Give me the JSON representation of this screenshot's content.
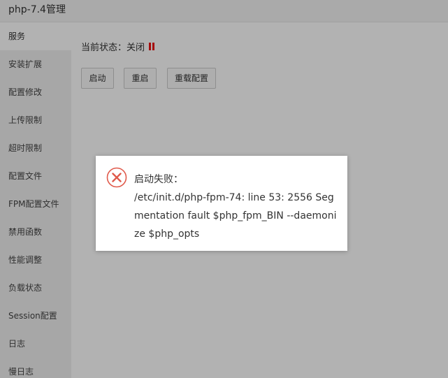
{
  "window": {
    "title": "php-7.4管理"
  },
  "sidebar": {
    "items": [
      {
        "label": "服务",
        "active": true
      },
      {
        "label": "安装扩展"
      },
      {
        "label": "配置修改"
      },
      {
        "label": "上传限制"
      },
      {
        "label": "超时限制"
      },
      {
        "label": "配置文件"
      },
      {
        "label": "FPM配置文件"
      },
      {
        "label": "禁用函数"
      },
      {
        "label": "性能调整"
      },
      {
        "label": "负载状态"
      },
      {
        "label": "Session配置"
      },
      {
        "label": "日志"
      },
      {
        "label": "慢日志"
      }
    ]
  },
  "main": {
    "status_label": "当前状态：关闭",
    "status_icon": "pause-icon",
    "status_color": "#ee1111",
    "buttons": {
      "start": "启动",
      "restart": "重启",
      "reload": "重载配置"
    }
  },
  "dialog": {
    "icon": "error-circle-icon",
    "icon_color": "#e05a4b",
    "title": "启动失败：",
    "message": "/etc/init.d/php-fpm-74: line 53: 2556 Segmentation fault $php_fpm_BIN --daemonize $php_opts"
  }
}
